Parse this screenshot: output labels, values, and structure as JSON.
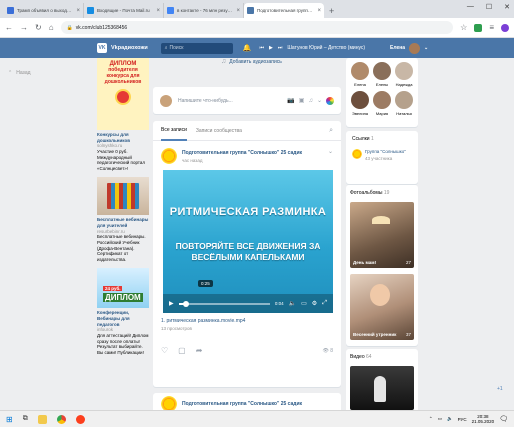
{
  "browser": {
    "tabs": [
      {
        "title": "Трамп объявил о выходе США",
        "color": "#3b6fd8"
      },
      {
        "title": "Входящие - Почта Mail.ru",
        "color": "#168de2"
      },
      {
        "title": "в контакте - 76 млн результатов",
        "color": "#4285f4"
      },
      {
        "title": "Подготовительная группа \"Сол",
        "color": "#4a76a8",
        "active": true
      }
    ],
    "new_tab": "+",
    "url": "vk.com/club125368456"
  },
  "vk": {
    "logo": "VK",
    "site_name": "Vkрадиохожи",
    "search_placeholder": "Поиск",
    "player_track": "Шатунов Юрий – Детство (минус)",
    "user_name": "Елена"
  },
  "left_menu": {
    "label": "Назад"
  },
  "music_line": "Добавить аудиозапись",
  "ads": [
    {
      "banner_lines": [
        "ДИПЛОМ",
        "победителя",
        "конкурса для",
        "дошкольников"
      ],
      "title": "Конкурсы для дошкольников",
      "site": "solnyshko.ru",
      "text": "Участие 0 руб. Международный педагогический портал «Солнцесвет»!"
    },
    {
      "title": "Бесплатные вебинары для учителей",
      "site": "resurbebinr.ru",
      "text": "Бесплатные вебинары. Российский Учебник (Дрофа-Вентана). Сертификат от издательства."
    },
    {
      "banner_lines": [
        "24 руб.",
        "ДИПЛОМ"
      ],
      "title": "Конференции, Вебинары для педагогов",
      "site": "infourok",
      "text": "Для аттестаций! Диплом сразу после оплаты! Результат выбирайте. Вы сами! Публикации!"
    }
  ],
  "composer": {
    "placeholder": "Напишите что-нибудь..."
  },
  "feed": {
    "tabs": [
      "Все записи",
      "Записи сообщества"
    ],
    "post": {
      "author": "Подготовительная группа \"Солнышко\" 25 садик",
      "time": "час назад",
      "video": {
        "title": "РИТМИЧЕСКАЯ РАЗМИНКА",
        "subtitle_lines": [
          "ПОВТОРЯЙТЕ ВСЕ ДВИЖЕНИЯ ЗА",
          "ВЕСЁЛЫМИ КАПЕЛЬКАМИ"
        ],
        "tooltip_time": "0:25",
        "duration": "0:04",
        "progress": 0.08
      },
      "video_name": "1. ритмическая разминка.movie.mp4",
      "views_label": "13 просмотров",
      "views_count": "8"
    },
    "post2_author": "Подготовительная группа \"Солнышко\" 25 садик"
  },
  "friends": [
    {
      "name": "Елена",
      "color": "#b08a6a"
    },
    {
      "name": "Елены",
      "color": "#8a6f5a"
    },
    {
      "name": "Надежда",
      "color": "#c8b7a6"
    },
    {
      "name": "Эвелина",
      "color": "#6d4f3d"
    },
    {
      "name": "Мария",
      "color": "#9c7b63"
    },
    {
      "name": "Наталья",
      "color": "#b5a18c"
    }
  ],
  "links_block": {
    "heading": "Ссылки",
    "count": "1",
    "name": "Группа \"Солнышко\"",
    "members": "43 участника"
  },
  "photos_block": {
    "heading": "Фотоальбомы",
    "count": "19",
    "albums": [
      {
        "label": "День мам!",
        "count": "27"
      },
      {
        "label": "Весенний утренник",
        "count": "37"
      }
    ]
  },
  "videos_block": {
    "heading": "Видео",
    "count": "64"
  },
  "scroll_top": "+1",
  "taskbar": {
    "lang": "РУС",
    "time": "20:38",
    "date": "21.05.2020"
  }
}
